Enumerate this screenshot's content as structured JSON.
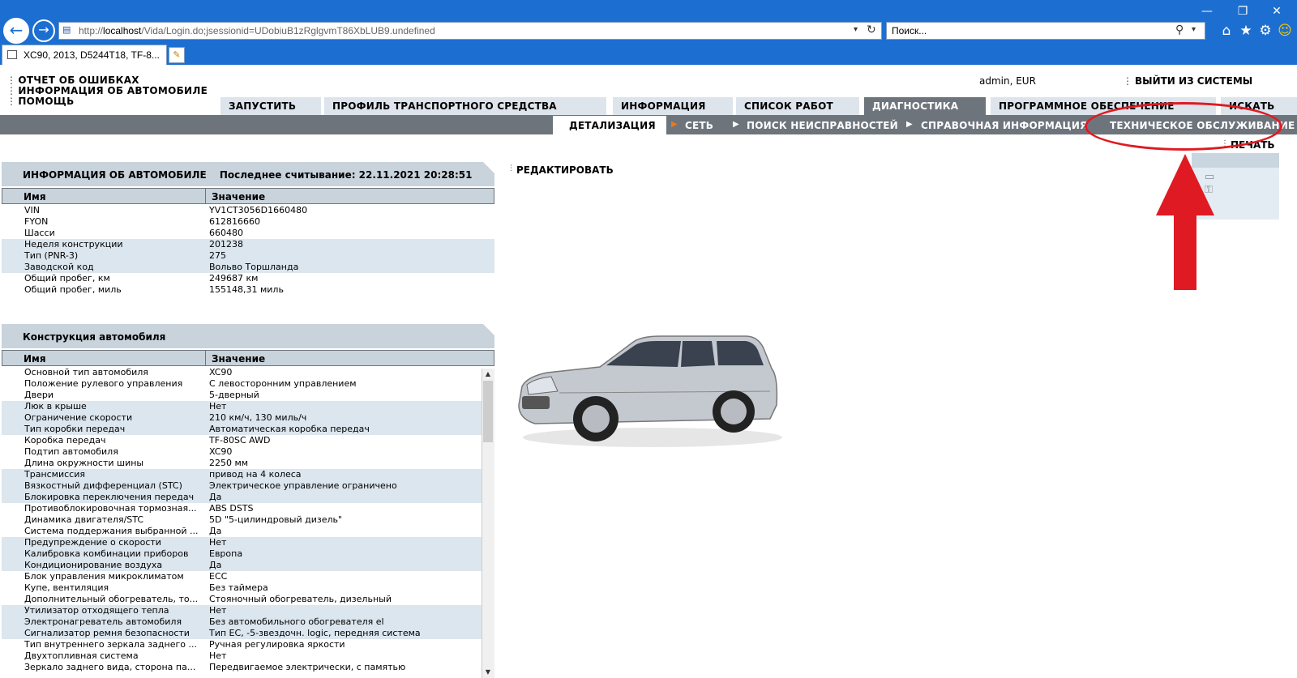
{
  "browser": {
    "url_prefix": "http://",
    "url_host": "localhost",
    "url_rest": "/Vida/Login.do;jsessionid=UDobiuB1zRglgvmT86XbLUB9.undefined",
    "search_placeholder": "Поиск...",
    "tab_title": "XC90, 2013, D5244T18, TF-8...",
    "icons": [
      "back-icon",
      "forward-icon",
      "refresh-icon",
      "search-icon",
      "home-icon",
      "favorites-star-icon",
      "settings-gear-icon",
      "smiley-icon",
      "minimize-icon",
      "restore-icon",
      "close-icon"
    ]
  },
  "app": {
    "top_links": [
      "ОТЧЕТ ОБ ОШИБКАХ",
      "ИНФОРМАЦИЯ ОБ АВТОМОБИЛЕ",
      "ПОМОЩЬ"
    ],
    "user": "admin, EUR",
    "logout": "ВЫЙТИ ИЗ СИСТЕМЫ",
    "tabs": [
      "ЗАПУСТИТЬ",
      "ПРОФИЛЬ ТРАНСПОРТНОГО СРЕДСТВА",
      "ИНФОРМАЦИЯ",
      "СПИСОК РАБОТ",
      "ДИАГНОСТИКА",
      "ПРОГРАММНОЕ ОБЕСПЕЧЕНИЕ",
      "ИСКАТЬ"
    ],
    "active_tab": "ДИАГНОСТИКА",
    "subtabs": [
      "ДЕТАЛИЗАЦИЯ",
      "СЕТЬ",
      "ПОИСК НЕИСПРАВНОСТЕЙ",
      "СПРАВОЧНАЯ ИНФОРМАЦИЯ",
      "ТЕХНИЧЕСКОЕ ОБСЛУЖИВАНИЕ"
    ],
    "active_subtab": "ДЕТАЛИЗАЦИЯ",
    "print": "ПЕЧАТЬ",
    "edit": "РЕДАКТИРОВАТЬ"
  },
  "vehicle_info": {
    "title": "ИНФОРМАЦИЯ ОБ АВТОМОБИЛЕ",
    "last_read": "Последнее считывание: 22.11.2021 20:28:51",
    "col_name": "Имя",
    "col_value": "Значение",
    "rows": [
      [
        "VIN",
        "YV1CT3056D1660480"
      ],
      [
        "FYON",
        "612816660"
      ],
      [
        "Шасси",
        "660480"
      ],
      [
        "Неделя конструкции",
        "201238"
      ],
      [
        "Тип (PNR-3)",
        "275"
      ],
      [
        "Заводской код",
        "Вольво Торшланда"
      ],
      [
        "Общий пробег, км",
        "249687 км"
      ],
      [
        "Общий пробег, миль",
        "155148,31 миль"
      ]
    ]
  },
  "construction": {
    "title": "Конструкция автомобиля",
    "col_name": "Имя",
    "col_value": "Значение",
    "rows": [
      [
        "Основной тип автомобиля",
        "XC90"
      ],
      [
        "Положение рулевого управления",
        "С левосторонним управлением"
      ],
      [
        "Двери",
        "5-дверный"
      ],
      [
        "Люк в крыше",
        "Нет"
      ],
      [
        "Ограничение скорости",
        "210 км/ч, 130 миль/ч"
      ],
      [
        "Тип коробки передач",
        "Автоматическая коробка передач"
      ],
      [
        "Коробка передач",
        "TF-80SC AWD"
      ],
      [
        "Подтип автомобиля",
        "XC90"
      ],
      [
        "Длина окружности шины",
        "2250 мм"
      ],
      [
        "Трансмиссия",
        "привод на 4 колеса"
      ],
      [
        "Вязкостный дифференциал (STC)",
        "Электрическое управление ограничено"
      ],
      [
        "Блокировка переключения передач",
        "Да"
      ],
      [
        "Противоблокировочная тормозная...",
        "ABS DSTS"
      ],
      [
        "Динамика двигателя/STC",
        "5D \"5-цилиндровый дизель\""
      ],
      [
        "Система поддержания выбранной ...",
        "Да"
      ],
      [
        "Предупреждение о скорости",
        "Нет"
      ],
      [
        "Калибровка комбинации приборов",
        "Европа"
      ],
      [
        "Кондиционирование воздуха",
        "Да"
      ],
      [
        "Блок управления микроклиматом",
        "ECC"
      ],
      [
        "Купе, вентиляция",
        "Без таймера"
      ],
      [
        "Дополнительный обогреватель, то...",
        "Стояночный обогреватель, дизельный"
      ],
      [
        "Утилизатор отходящего тепла",
        "Нет"
      ],
      [
        "Электронагреватель автомобиля",
        "Без автомобильного обогревателя el"
      ],
      [
        "Сигнализатор ремня безопасности",
        "Тип EC, -5-звездочн. logic, передняя система"
      ],
      [
        "Тип внутреннего зеркала заднего ...",
        "Ручная регулировка яркости"
      ],
      [
        "Двухтопливная система",
        "Нет"
      ],
      [
        "Зеркало заднего вида, сторона па...",
        "Передвигаемое электрически, с памятью"
      ]
    ]
  },
  "colors": {
    "browser_blue": "#1c6fd1",
    "tab_inactive": "#dde4ec",
    "tab_active": "#6d747c",
    "highlight_red": "#e01a22"
  }
}
